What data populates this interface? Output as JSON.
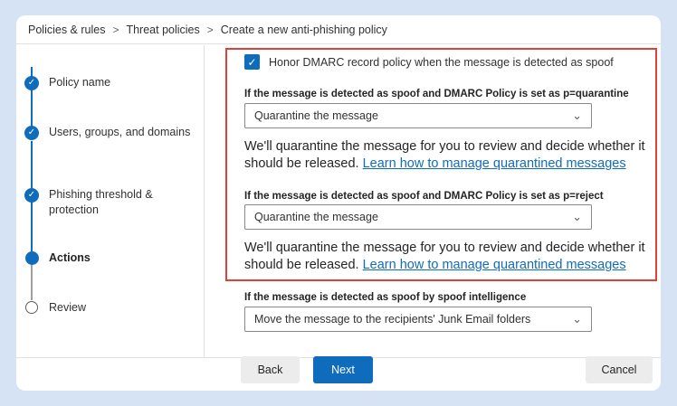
{
  "breadcrumb": {
    "items": [
      "Policies & rules",
      "Threat policies",
      "Create a new anti-phishing policy"
    ],
    "separator": ">"
  },
  "steps": [
    {
      "label": "Policy name",
      "state": "done"
    },
    {
      "label": "Users, groups, and domains",
      "state": "done"
    },
    {
      "label": "Phishing threshold & protection",
      "state": "done"
    },
    {
      "label": "Actions",
      "state": "current"
    },
    {
      "label": "Review",
      "state": "pending"
    }
  ],
  "form": {
    "honor_dmarc": {
      "label": "Honor DMARC record policy when the message is detected as spoof",
      "checked": true
    },
    "quarantine_section": {
      "label": "If the message is detected as spoof and DMARC Policy is set as p=quarantine",
      "selected": "Quarantine the message",
      "description": "We'll quarantine the message for you to review and decide whether it should be released.",
      "link": "Learn how to manage quarantined messages"
    },
    "reject_section": {
      "label": "If the message is detected as spoof and DMARC Policy is set as p=reject",
      "selected": "Quarantine the message",
      "description": "We'll quarantine the message for you to review and decide whether it should be released.",
      "link": "Learn how to manage quarantined messages"
    },
    "spoof_intel_section": {
      "label": "If the message is detected as spoof by spoof intelligence",
      "selected": "Move the message to the recipients' Junk Email folders"
    }
  },
  "buttons": {
    "back": "Back",
    "next": "Next",
    "cancel": "Cancel"
  },
  "icons": {
    "checkmark": "check-icon",
    "chevron": "chevron-down-icon",
    "breadcrumb_sep": "chevron-right-icon"
  },
  "colors": {
    "accent": "#0f6cbd",
    "highlight_border": "#e0403c",
    "background": "#d6e3f5"
  }
}
